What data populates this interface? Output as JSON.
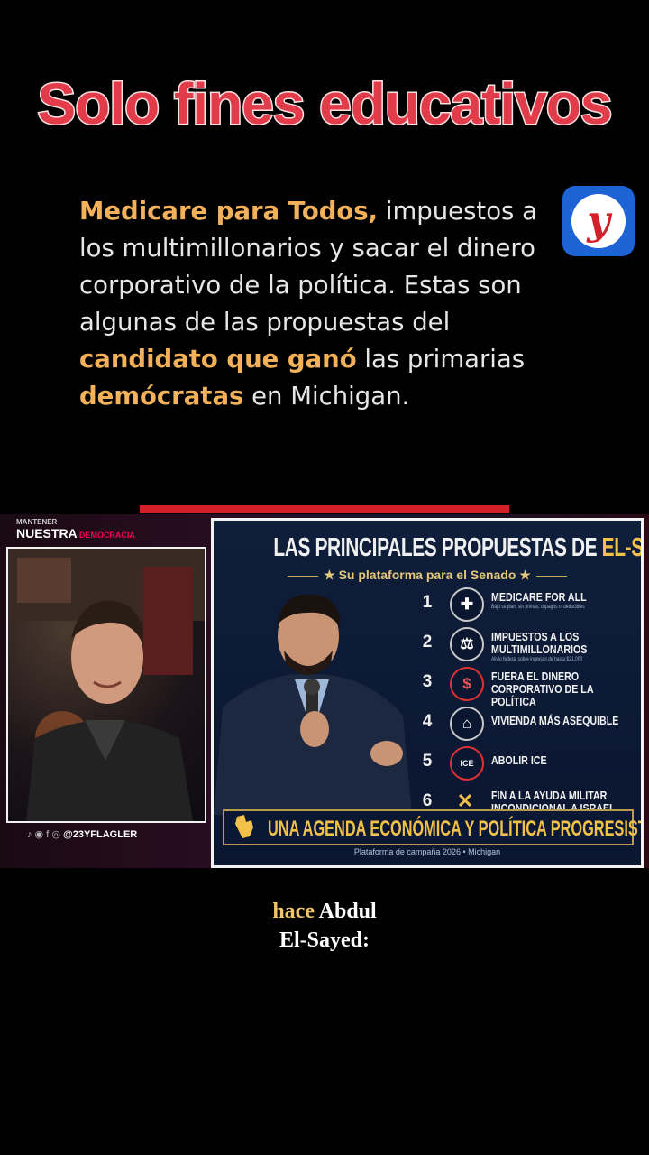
{
  "overlay": {
    "watermark": "Solo fines educativos"
  },
  "article": {
    "seg1_highlight": "Medicare para Todos,",
    "seg2": " impuestos a los multimillonarios y sacar el dinero corporativo de la política. Estas son algunas de las propuestas del ",
    "seg3_highlight": "candidato que ganó",
    "seg4": " las primarias ",
    "seg5_highlight": "demócratas",
    "seg6": " en Michigan."
  },
  "channel_logo": {
    "letter": "y"
  },
  "host_panel": {
    "top_small": "MANTENER",
    "top_big": "NUESTRA",
    "top_red": "DEMOCRACIA",
    "handle": "@23YFLAGLER"
  },
  "poster": {
    "title_white": "LAS PRINCIPALES PROPUESTAS DE ",
    "title_gold": "EL-SAYED",
    "subtitle": "★ Su plataforma para el Senado ★",
    "proposals": [
      {
        "n": "1",
        "icon": "✚",
        "label": "MEDICARE FOR ALL",
        "detail": "Bajo su plan: sin primas, copagos ni deducibles"
      },
      {
        "n": "2",
        "icon": "⚖",
        "label": "IMPUESTOS A LOS MULTIMILLONARIOS",
        "detail": "Alivio federal sobre ingresos de hasta $21,000"
      },
      {
        "n": "3",
        "icon": "$",
        "label": "FUERA EL DINERO CORPORATIVO DE LA POLÍTICA",
        "detail": ""
      },
      {
        "n": "4",
        "icon": "⌂",
        "label": "VIVIENDA MÁS ASEQUIBLE",
        "detail": ""
      },
      {
        "n": "5",
        "icon": "ICE",
        "label": "ABOLIR ICE",
        "detail": ""
      },
      {
        "n": "6",
        "icon": "✕",
        "label": "FIN A LA AYUDA MILITAR INCONDICIONAL A ISRAEL",
        "detail": ""
      }
    ],
    "banner": "UNA AGENDA ECONÓMICA Y POLÍTICA PROGRESISTA",
    "footer": "Plataforma de campaña 2026 • Michigan"
  },
  "caption": {
    "gold": "hace",
    "white_1": " Abdul",
    "white_2": "El-Sayed:"
  }
}
